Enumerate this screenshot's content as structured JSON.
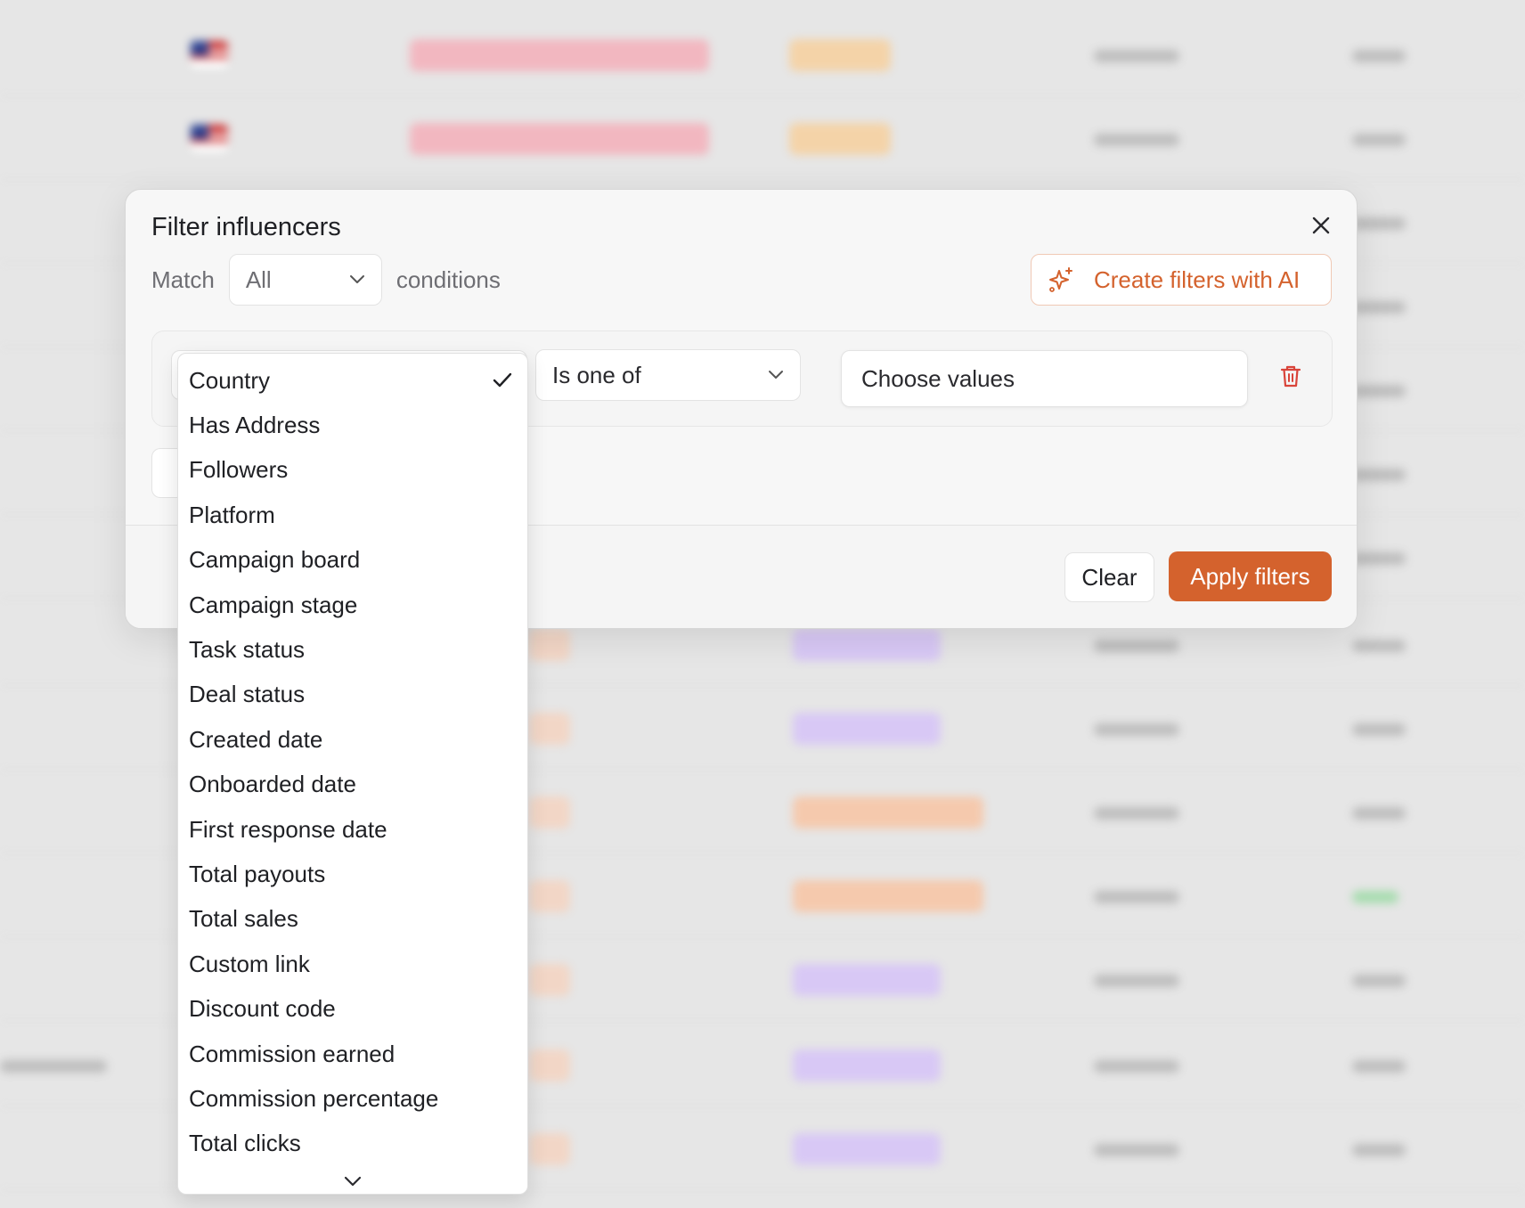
{
  "modal": {
    "title": "Filter influencers",
    "match_label": "Match",
    "match_value": "All",
    "conditions_label": "conditions",
    "ai_button_label": "Create filters with AI",
    "condition": {
      "field": "Country",
      "operator": "Is one of",
      "values_placeholder": "Choose values"
    },
    "footer": {
      "clear_label": "Clear",
      "apply_label": "Apply filters"
    }
  },
  "field_dropdown": {
    "selected": "Country",
    "items": [
      "Country",
      "Has Address",
      "Followers",
      "Platform",
      "Campaign board",
      "Campaign stage",
      "Task status",
      "Deal status",
      "Created date",
      "Onboarded date",
      "First response date",
      "Total payouts",
      "Total sales",
      "Custom link",
      "Discount code",
      "Commission earned",
      "Commission percentage",
      "Total clicks"
    ]
  },
  "icons": {
    "close": "close-icon",
    "chevron": "chevron-down-icon",
    "ai": "sparkles-icon",
    "delete": "trash-icon",
    "check": "check-icon"
  },
  "colors": {
    "accent": "#d4622d",
    "delete": "#d9443a",
    "backdrop": "#e6e6e6"
  }
}
